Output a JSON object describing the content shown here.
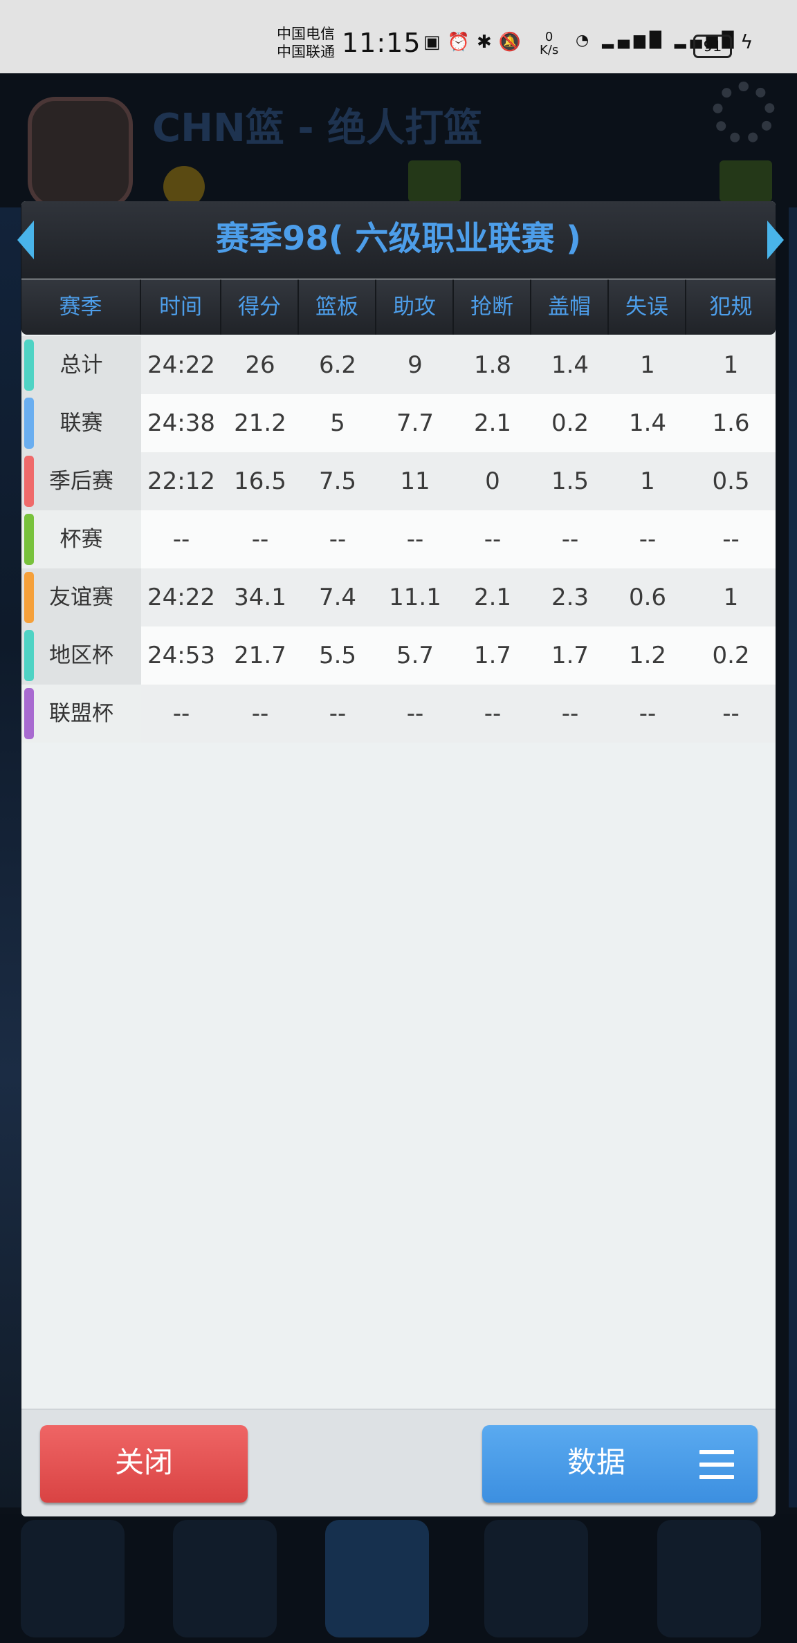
{
  "status_bar": {
    "carrier1": "中国电信",
    "carrier2": "中国联通",
    "time": "11:15",
    "net_speed_value": "0",
    "net_speed_unit": "K/s",
    "battery": "91"
  },
  "background": {
    "title": "CHN篮 - 绝人打篮"
  },
  "dialog": {
    "title": "赛季98( 六级职业联赛 )",
    "columns": [
      "赛季",
      "时间",
      "得分",
      "篮板",
      "助攻",
      "抢断",
      "盖帽",
      "失误",
      "犯规"
    ],
    "rows": [
      {
        "label": "总计",
        "color": "#4fd3c4",
        "values": [
          "24:22",
          "26",
          "6.2",
          "9",
          "1.8",
          "1.4",
          "1",
          "1"
        ]
      },
      {
        "label": "联赛",
        "color": "#6aaef0",
        "values": [
          "24:38",
          "21.2",
          "5",
          "7.7",
          "2.1",
          "0.2",
          "1.4",
          "1.6"
        ]
      },
      {
        "label": "季后赛",
        "color": "#ef6a6a",
        "values": [
          "22:12",
          "16.5",
          "7.5",
          "11",
          "0",
          "1.5",
          "1",
          "0.5"
        ]
      },
      {
        "label": "杯赛",
        "color": "#78c23c",
        "values": [
          "--",
          "--",
          "--",
          "--",
          "--",
          "--",
          "--",
          "--"
        ]
      },
      {
        "label": "友谊赛",
        "color": "#f5a03a",
        "values": [
          "24:22",
          "34.1",
          "7.4",
          "11.1",
          "2.1",
          "2.3",
          "0.6",
          "1"
        ]
      },
      {
        "label": "地区杯",
        "color": "#4fd3c4",
        "values": [
          "24:53",
          "21.7",
          "5.5",
          "5.7",
          "1.7",
          "1.7",
          "1.2",
          "0.2"
        ]
      },
      {
        "label": "联盟杯",
        "color": "#a86ad0",
        "values": [
          "--",
          "--",
          "--",
          "--",
          "--",
          "--",
          "--",
          "--"
        ]
      }
    ],
    "close_label": "关闭",
    "data_label": "数据"
  }
}
